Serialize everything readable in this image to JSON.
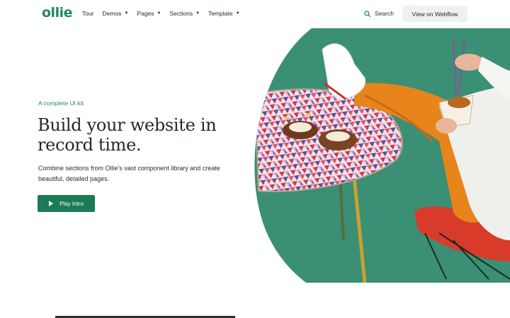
{
  "header": {
    "logo": "ollie",
    "nav": [
      {
        "label": "Tour",
        "has_dropdown": false
      },
      {
        "label": "Demos",
        "has_dropdown": true
      },
      {
        "label": "Pages",
        "has_dropdown": true
      },
      {
        "label": "Sections",
        "has_dropdown": true
      },
      {
        "label": "Template",
        "has_dropdown": true
      }
    ],
    "search_label": "Search",
    "search_icon": "search-icon",
    "cta_label": "View on Webflow"
  },
  "hero": {
    "eyebrow": "A complete UI kit",
    "headline_line1": "Build your website in",
    "headline_line2": "record time.",
    "subtext": "Combine sections from Ollie's vast component library and create beautiful, detailed pages.",
    "play_button_label": "Play Intro",
    "play_icon": "play-icon"
  },
  "colors": {
    "brand_green": "#1f8a5e",
    "button_green": "#1b7b57",
    "image_backdrop": "#3a8f74",
    "pants_orange": "#e8841c",
    "chair_red": "#d93b2b"
  }
}
